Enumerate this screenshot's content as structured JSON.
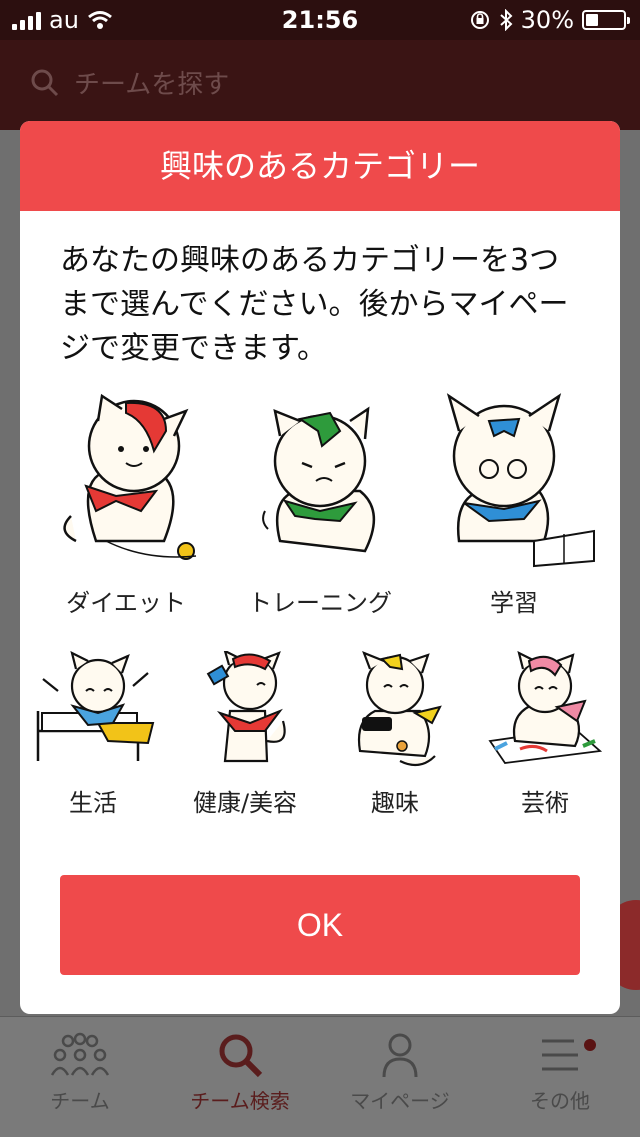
{
  "status_bar": {
    "carrier": "au",
    "time": "21:56",
    "battery": "30%"
  },
  "header": {
    "search_placeholder": "チームを探す"
  },
  "modal": {
    "title": "興味のあるカテゴリー",
    "description": "あなたの興味のあるカテゴリーを3つまで選んでください。後からマイページで変更できます。",
    "categories_row1": [
      {
        "label": "ダイエット",
        "color": "#e53935"
      },
      {
        "label": "トレーニング",
        "color": "#2e9b3c"
      },
      {
        "label": "学習",
        "color": "#2f8fd6"
      }
    ],
    "categories_row2": [
      {
        "label": "生活",
        "color": "#4aa3df"
      },
      {
        "label": "健康/美容",
        "color": "#e53935"
      },
      {
        "label": "趣味",
        "color": "#f2d21e"
      },
      {
        "label": "芸術",
        "color": "#f08aa5"
      }
    ],
    "ok_label": "OK"
  },
  "tabbar": {
    "tabs": [
      {
        "label": "チーム",
        "icon": "team-icon"
      },
      {
        "label": "チーム検索",
        "icon": "search-icon"
      },
      {
        "label": "マイページ",
        "icon": "person-icon"
      },
      {
        "label": "その他",
        "icon": "menu-icon"
      }
    ]
  },
  "colors": {
    "accent": "#ef4a4b",
    "overlay": "#6f6f6f"
  }
}
